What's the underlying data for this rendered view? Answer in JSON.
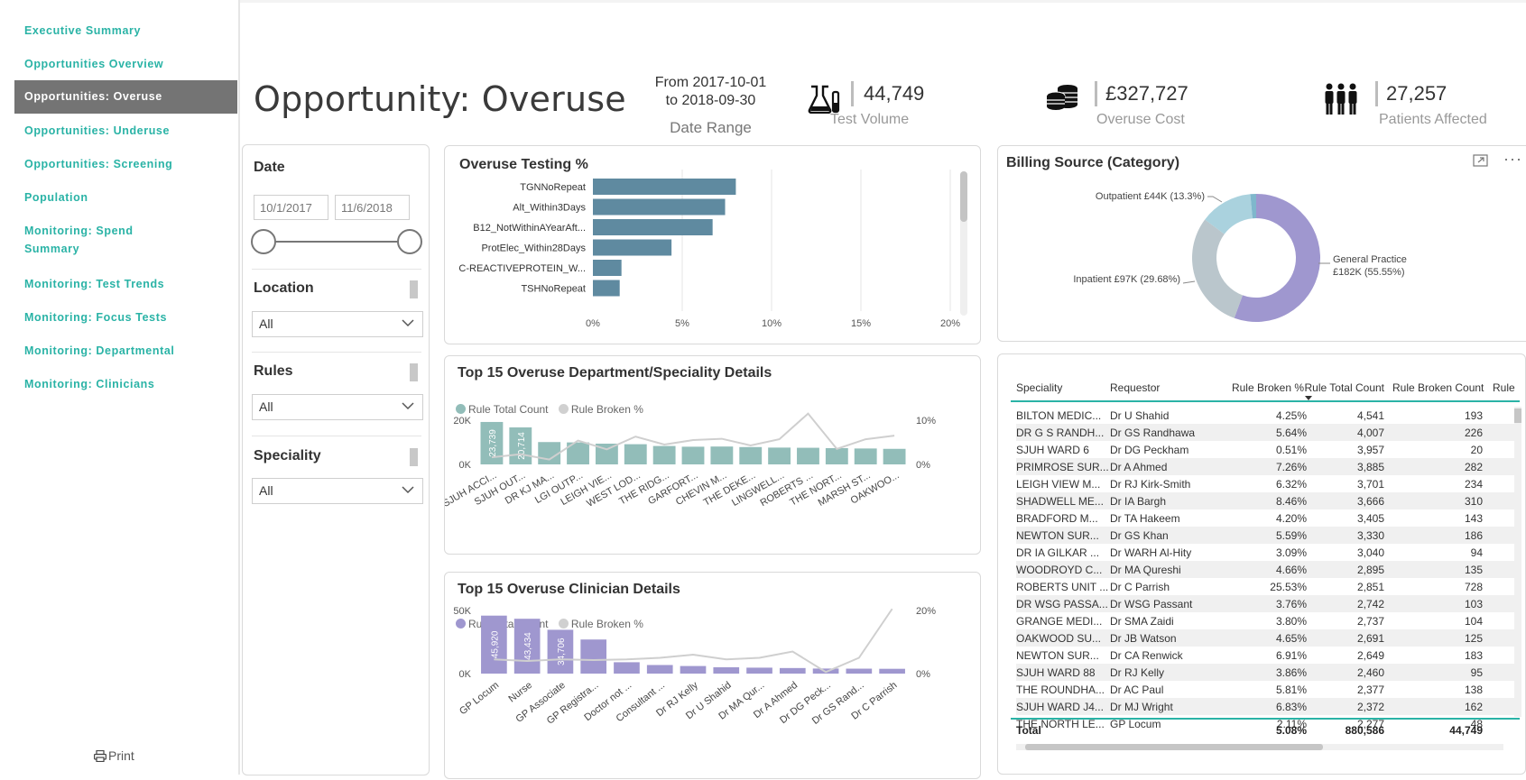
{
  "nav": {
    "items": [
      {
        "label": "Executive Summary",
        "active": false
      },
      {
        "label": "Opportunities Overview",
        "active": false
      },
      {
        "label": "Opportunities: Overuse",
        "active": true
      },
      {
        "label": "Opportunities: Underuse",
        "active": false
      },
      {
        "label": "Opportunities: Screening",
        "active": false
      },
      {
        "label": "Population",
        "active": false
      },
      {
        "label": "Monitoring: Spend\nSummary",
        "active": false
      },
      {
        "label": "Monitoring: Test Trends",
        "active": false
      },
      {
        "label": "Monitoring: Focus Tests",
        "active": false
      },
      {
        "label": "Monitoring: Departmental",
        "active": false
      },
      {
        "label": "Monitoring: Clinicians",
        "active": false
      }
    ],
    "print_label": "Print"
  },
  "header": {
    "title": "Opportunity: Overuse",
    "date_from": "From 2017-10-01",
    "date_to": "to 2018-09-30",
    "date_caption": "Date Range",
    "kpis": [
      {
        "icon": "flask-icon",
        "value": "44,749",
        "label": "Test Volume"
      },
      {
        "icon": "coins-icon",
        "value": "£327,727",
        "label": "Overuse Cost"
      },
      {
        "icon": "people-icon",
        "value": "27,257",
        "label": "Patients Affected"
      }
    ]
  },
  "filters": {
    "date_title": "Date",
    "date_start": "10/1/2017",
    "date_end": "11/6/2018",
    "location_title": "Location",
    "location_value": "All",
    "rules_title": "Rules",
    "rules_value": "All",
    "speciality_title": "Speciality",
    "speciality_value": "All"
  },
  "colors": {
    "accent": "#2ab3a6",
    "overuse_bar": "#5f8aa0",
    "dept_bar": "#92bdb9",
    "clin_bar": "#9f97cf",
    "line": "#cfcfcf",
    "donut_gp": "#9f97cf",
    "donut_inpatient": "#bac6cc",
    "donut_outpatient": "#aad2de"
  },
  "overuse_chart": {
    "title": "Overuse Testing %",
    "chart_data": {
      "type": "bar",
      "orientation": "horizontal",
      "categories": [
        "TGNNoRepeat",
        "Alt_Within3Days",
        "B12_NotWithinAYearAft...",
        "ProtElec_Within28Days",
        "C-REACTIVEPROTEIN_W...",
        "TSHNoRepeat"
      ],
      "values": [
        8.0,
        7.4,
        6.7,
        4.4,
        1.6,
        1.5
      ],
      "xticks": [
        "0%",
        "5%",
        "10%",
        "15%",
        "20%"
      ],
      "xlim": [
        0,
        20
      ]
    }
  },
  "billing_chart": {
    "title": "Billing Source (Category)",
    "chart_data": {
      "type": "pie",
      "donut": true,
      "slices": [
        {
          "label": "General Practice",
          "sub": "£182K (55.55%)",
          "value": 55.55
        },
        {
          "label": "Inpatient £97K (29.68%)",
          "value": 29.68
        },
        {
          "label": "Outpatient £44K (13.3%)",
          "value": 13.3
        },
        {
          "label": "",
          "value": 1.47
        }
      ]
    }
  },
  "dept_chart": {
    "title": "Top 15 Overuse Department/Speciality Details",
    "legend": [
      "Rule Total Count",
      "Rule Broken %"
    ],
    "chart_data": {
      "type": "bar",
      "categories": [
        "SJUH ACCI...",
        "SJUH OUT...",
        "DR KJ MA...",
        "LGI OUTP...",
        "LEIGH VIE...",
        "WEST LOD...",
        "THE RIDG...",
        "GARFORT...",
        "CHEVIN M...",
        "THE DEKE...",
        "LINGWELL...",
        "ROBERTS ...",
        "THE NORT...",
        "MARSH ST...",
        "OAKWOO..."
      ],
      "series": [
        {
          "name": "Rule Total Count",
          "values": [
            23739,
            20714,
            12500,
            12300,
            11600,
            11300,
            10300,
            9900,
            10000,
            9700,
            9400,
            9300,
            9100,
            8900,
            8700
          ]
        },
        {
          "name": "Rule Broken %",
          "values": [
            1.6,
            2.3,
            1.1,
            5.4,
            3.4,
            6.3,
            4.5,
            5.5,
            5.8,
            4.3,
            5.7,
            11.5,
            3.5,
            5.7,
            6.5
          ]
        }
      ],
      "bar_labels": [
        "23,739",
        "20,714"
      ],
      "y_ticks": [
        "20K",
        "0K"
      ],
      "y2_ticks": [
        "10%",
        "0%"
      ]
    }
  },
  "clin_chart": {
    "title": "Top 15 Overuse Clinician Details",
    "legend": [
      "Rule Total Count",
      "Rule Broken %"
    ],
    "chart_data": {
      "type": "bar",
      "categories": [
        "GP Locum",
        "Nurse",
        "GP Associate",
        "GP Registra...",
        "Doctor not ...",
        "Consultant ...",
        "Dr RJ Kelly",
        "Dr U Shahid",
        "Dr MA Qur...",
        "Dr A Ahmed",
        "Dr DG Peck...",
        "Dr GS Rand...",
        "Dr C Parrish"
      ],
      "series": [
        {
          "name": "Rule Total Count",
          "values": [
            45920,
            43434,
            34706,
            27000,
            9000,
            6800,
            6000,
            5000,
            4700,
            4400,
            4000,
            3900,
            3800
          ]
        },
        {
          "name": "Rule Broken %",
          "values": [
            4.5,
            4.0,
            4.5,
            4.3,
            4.5,
            5.0,
            6.0,
            4.5,
            5.0,
            7.0,
            0.5,
            5.0,
            20.5
          ]
        }
      ],
      "bar_labels": [
        "45,920",
        "43,434",
        "34,706"
      ],
      "y_ticks": [
        "50K",
        "0K"
      ],
      "y2_ticks": [
        "20%",
        "0%"
      ]
    }
  },
  "table": {
    "headers": [
      "Speciality",
      "Requestor",
      "Rule Broken %",
      "Rule Total Count",
      "Rule Broken Count",
      "Rule"
    ],
    "rows": [
      [
        "BILTON MEDIC...",
        "Dr U Shahid",
        "4.25%",
        "4,541",
        "193"
      ],
      [
        "DR G S RANDH...",
        "Dr GS Randhawa",
        "5.64%",
        "4,007",
        "226"
      ],
      [
        "SJUH WARD 6",
        "Dr DG Peckham",
        "0.51%",
        "3,957",
        "20"
      ],
      [
        "PRIMROSE SUR...",
        "Dr A Ahmed",
        "7.26%",
        "3,885",
        "282"
      ],
      [
        "LEIGH VIEW M...",
        "Dr RJ Kirk-Smith",
        "6.32%",
        "3,701",
        "234"
      ],
      [
        "SHADWELL ME...",
        "Dr IA Bargh",
        "8.46%",
        "3,666",
        "310"
      ],
      [
        "BRADFORD M...",
        "Dr TA Hakeem",
        "4.20%",
        "3,405",
        "143"
      ],
      [
        "NEWTON SUR...",
        "Dr GS Khan",
        "5.59%",
        "3,330",
        "186"
      ],
      [
        "DR IA GILKAR ...",
        "Dr WARH Al-Hity",
        "3.09%",
        "3,040",
        "94"
      ],
      [
        "WOODROYD C...",
        "Dr MA Qureshi",
        "4.66%",
        "2,895",
        "135"
      ],
      [
        "ROBERTS UNIT ...",
        "Dr C Parrish",
        "25.53%",
        "2,851",
        "728"
      ],
      [
        "DR WSG PASSA...",
        "Dr WSG Passant",
        "3.76%",
        "2,742",
        "103"
      ],
      [
        "GRANGE MEDI...",
        "Dr SMA Zaidi",
        "3.80%",
        "2,737",
        "104"
      ],
      [
        "OAKWOOD SU...",
        "Dr JB Watson",
        "4.65%",
        "2,691",
        "125"
      ],
      [
        "NEWTON SUR...",
        "Dr CA Renwick",
        "6.91%",
        "2,649",
        "183"
      ],
      [
        "SJUH WARD 88",
        "Dr RJ Kelly",
        "3.86%",
        "2,460",
        "95"
      ],
      [
        "THE ROUNDHA...",
        "Dr AC Paul",
        "5.81%",
        "2,377",
        "138"
      ],
      [
        "SJUH WARD J4...",
        "Dr MJ Wright",
        "6.83%",
        "2,372",
        "162"
      ],
      [
        "THE NORTH LE...",
        "GP Locum",
        "2.11%",
        "2,277",
        "48"
      ]
    ],
    "total": {
      "label": "Total",
      "broken_pct": "5.08%",
      "total_count": "880,586",
      "broken_count": "44,749"
    }
  }
}
